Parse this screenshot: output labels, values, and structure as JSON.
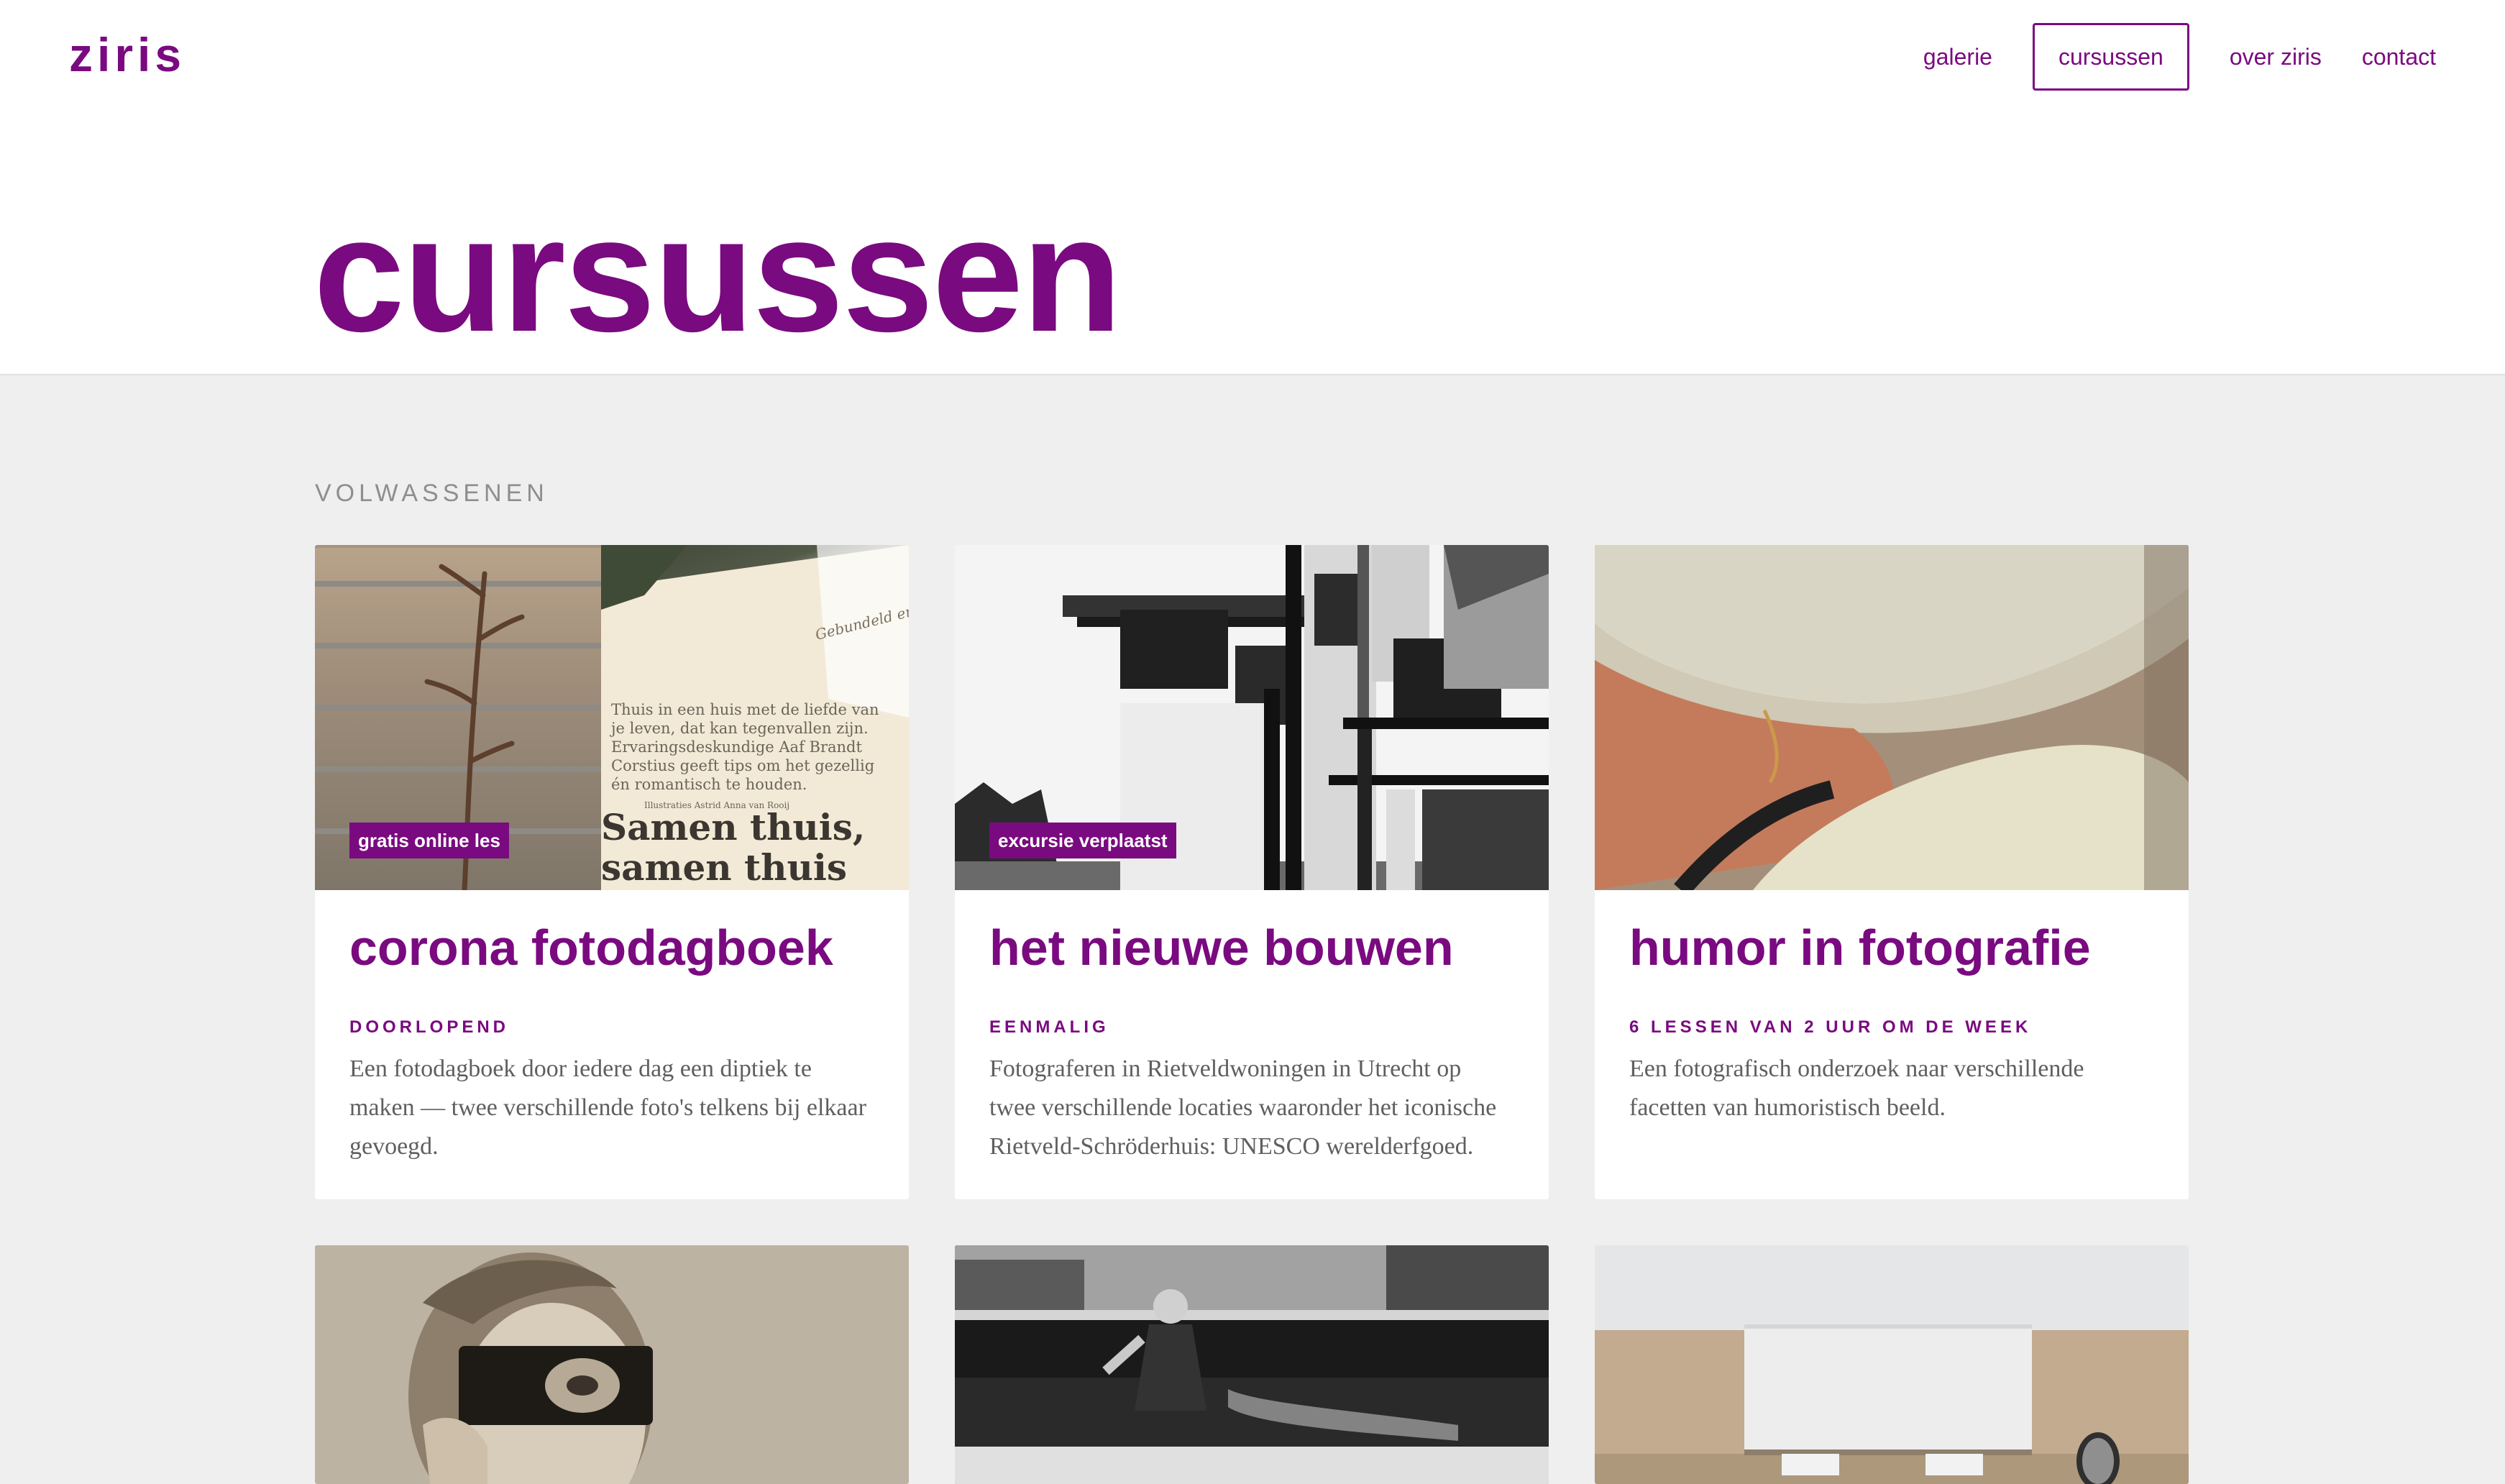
{
  "site": {
    "logo": "ziris"
  },
  "nav": {
    "items": [
      {
        "label": "galerie",
        "active": false
      },
      {
        "label": "cursussen",
        "active": true
      },
      {
        "label": "over ziris",
        "active": false
      },
      {
        "label": "contact",
        "active": false
      }
    ]
  },
  "page": {
    "title": "cursussen",
    "section_label": "VOLWASSENEN"
  },
  "colors": {
    "brand": "#7a0a80",
    "background": "#efefef",
    "section_label": "#8e8e8e",
    "body_text": "#5f5f5f"
  },
  "cards": [
    {
      "title": "corona fotodagboek",
      "badge": "gratis online les",
      "meta": "DOORLOPEND",
      "description": [
        "Een fotodagboek door iedere dag een diptiek te",
        "maken — twee verschillende foto's telkens bij elkaar",
        "gevoegd."
      ]
    },
    {
      "title": "het nieuwe bouwen",
      "badge": "excursie verplaatst",
      "meta": "EENMALIG",
      "description": [
        "Fotograferen in Rietveldwoningen in Utrecht op",
        "twee verschillende locaties waaronder het iconische",
        "Rietveld-Schröderhuis: UNESCO werelderfgoed."
      ]
    },
    {
      "title": "humor in fotografie",
      "meta": "6 LESSEN VAN 2 UUR OM DE WEEK",
      "description": [
        "Een fotografisch onderzoek naar verschillende",
        "facetten van humoristisch beeld."
      ]
    }
  ],
  "newspaper": {
    "heading": "Gebundeld en geknev",
    "body_lines": [
      "Thuis in een huis met de liefde van",
      "je leven, dat kan tegenvallen zijn.",
      "Ervaringsdeskundige Aaf Brandt",
      "Corstius geeft tips om het gezellig",
      "én romantisch te houden."
    ],
    "credit": "Illustraties Astrid Anna van Rooij",
    "headline_1": "Samen thuis,",
    "headline_2": "samen thuis"
  }
}
